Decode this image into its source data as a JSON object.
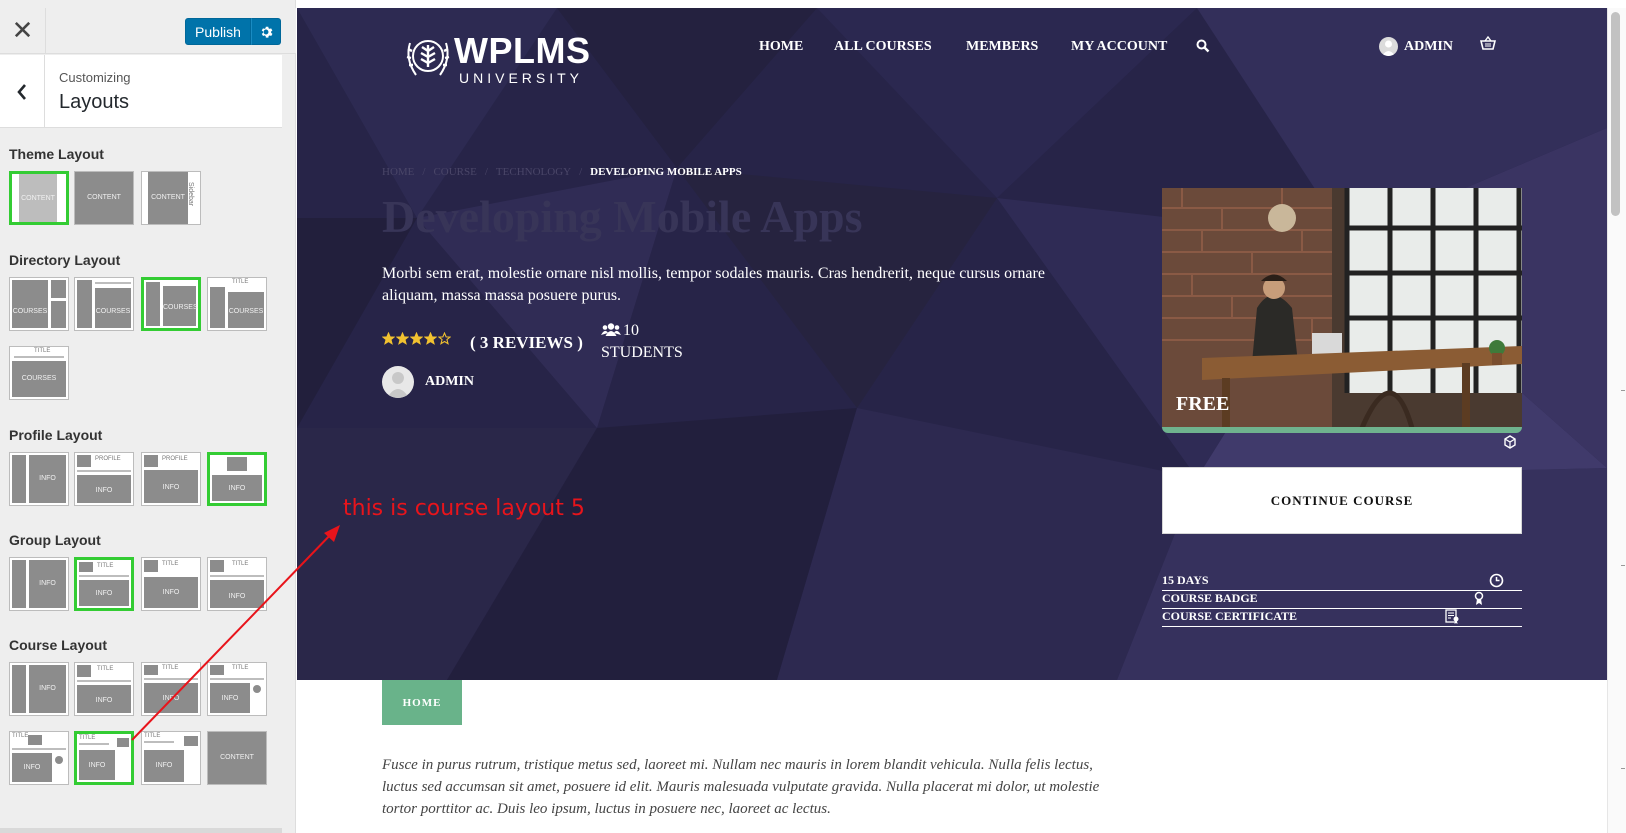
{
  "customizer": {
    "close_icon": "close-icon",
    "publish_label": "Publish",
    "settings_icon": "gear-icon",
    "back_icon": "chevron-left-icon",
    "customizing_label": "Customizing",
    "section_title": "Layouts",
    "selected_color": "#33cc33",
    "groups": [
      {
        "label": "Theme Layout",
        "thumb_labels": [
          "CONTENT",
          "CONTENT",
          "CONTENT",
          "Sidebar"
        ]
      },
      {
        "label": "Directory Layout",
        "thumb_labels": [
          "COURSES",
          "COURSES",
          "COURSES",
          "TITLE",
          "COURSES",
          "TITLE",
          "COURSES"
        ]
      },
      {
        "label": "Profile Layout",
        "thumb_labels": [
          "INFO",
          "PROFILE",
          "INFO",
          "PROFILE",
          "INFO",
          "INFO"
        ]
      },
      {
        "label": "Group Layout",
        "thumb_labels": [
          "INFO",
          "TITLE",
          "INFO",
          "TITLE",
          "INFO",
          "TITLE",
          "INFO"
        ]
      },
      {
        "label": "Course Layout",
        "thumb_labels": [
          "INFO",
          "TITLE",
          "INFO",
          "TITLE",
          "INFO",
          "TITLE",
          "INFO",
          "TITLE",
          "INFO",
          "TITLE",
          "INFO",
          "TITLE",
          "INFO",
          "CONTENT"
        ]
      }
    ]
  },
  "site": {
    "logo_title": "WPLMS",
    "logo_subtitle": "UNIVERSITY",
    "nav": [
      "HOME",
      "ALL COURSES",
      "MEMBERS",
      "MY ACCOUNT"
    ],
    "account_name": "ADMIN",
    "breadcrumb": [
      "HOME",
      "/",
      "COURSE",
      "/",
      "TECHNOLOGY",
      "/",
      "DEVELOPING MOBILE APPS"
    ],
    "course_title": "Developing Mobile Apps",
    "course_description": "Morbi sem erat, molestie ornare nisl mollis, tempor sodales mauris. Cras hendrerit, neque cursus ornare aliquam, massa massa posuere purus.",
    "rating": 4,
    "rating_max": 5,
    "reviews": "( 3 REVIEWS )",
    "students_count": "10",
    "students_label": "STUDENTS",
    "instructor": "ADMIN",
    "price": "FREE",
    "progress": 1.0,
    "continue_label": "CONTINUE COURSE",
    "details": [
      "15 DAYS",
      "COURSE BADGE",
      "COURSE CERTIFICATE"
    ],
    "tab_home": "HOME",
    "body_text": "Fusce in purus rutrum, tristique metus sed, laoreet mi. Nullam nec mauris in lorem blandit vehicula. Nulla felis lectus, luctus sed accumsan sit amet, posuere id elit. Mauris malesuada vulputate gravida. Nulla placerat mi dolor, ut molestie tortor porttitor ac. Duis leo ipsum, luctus in posuere nec, laoreet ac lectus.",
    "accent_color": "#69b38a",
    "hero_color": "#272448"
  },
  "annotation": {
    "text": "this is course layout 5",
    "color": "#e8141b"
  }
}
